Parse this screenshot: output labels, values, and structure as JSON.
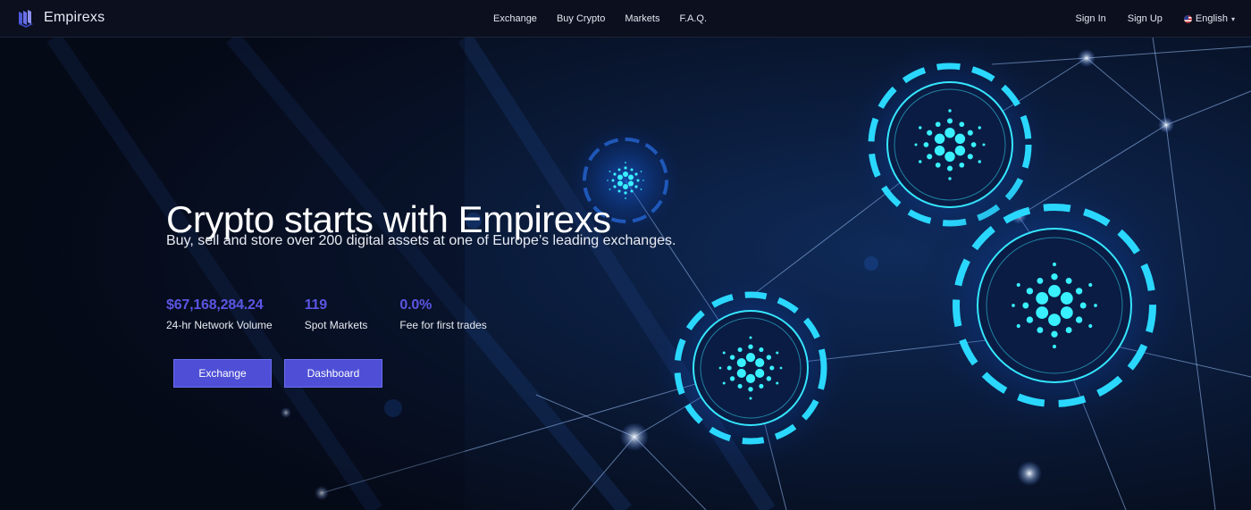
{
  "brand": {
    "name": "Empirexs"
  },
  "nav": {
    "center": [
      "Exchange",
      "Buy Crypto",
      "Markets",
      "F.A.Q."
    ],
    "signin": "Sign In",
    "signup": "Sign Up",
    "language": "English"
  },
  "hero": {
    "title": "Crypto starts with Empirexs",
    "subtitle": "Buy, sell and store over 200 digital assets at one of Europe’s leading exchanges.",
    "stats": [
      {
        "value": "$67,168,284.24",
        "label": "24-hr Network Volume"
      },
      {
        "value": "119",
        "label": "Spot Markets"
      },
      {
        "value": "0.0%",
        "label": "Fee for first trades"
      }
    ],
    "buttons": {
      "exchange": "Exchange",
      "dashboard": "Dashboard"
    }
  },
  "colors": {
    "accent": "#4e4fd6",
    "stat": "#5b55e3",
    "background": "#070d1c",
    "glow": "#1fd3ff"
  }
}
